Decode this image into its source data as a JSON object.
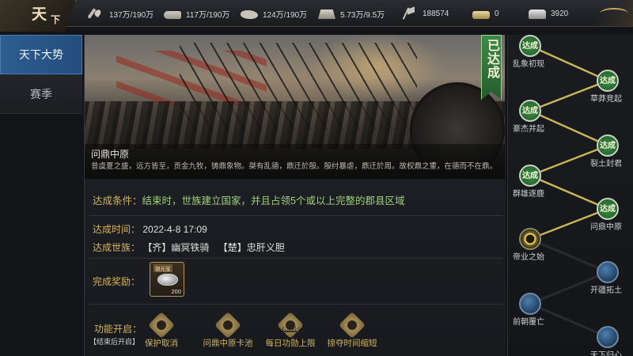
{
  "header": {
    "logo_char_1": "天",
    "logo_char_2": "下",
    "resources": [
      {
        "icon": "wheat-icon",
        "value": "137万/190万"
      },
      {
        "icon": "wood-icon",
        "value": "117万/190万"
      },
      {
        "icon": "stone-icon",
        "value": "124万/190万"
      },
      {
        "icon": "iron-icon",
        "value": "5.73万/9.5万"
      },
      {
        "icon": "flag-icon",
        "value": "188574"
      },
      {
        "icon": "gold-icon",
        "value": "0"
      },
      {
        "icon": "silver-icon",
        "value": "3920"
      }
    ]
  },
  "tabs": [
    {
      "label": "天下大势",
      "active": true
    },
    {
      "label": "赛季",
      "active": false
    }
  ],
  "event": {
    "badge": "已达成",
    "title": "问鼎中原",
    "description": "昔虞夏之盛，远方皆至，贡金九牧，铸鼎象物。桀有乱德，鼎迁於殷。殷纣暴虐，鼎迁於周。故权鼎之重，在德而不在鼎。",
    "condition_label": "达成条件：",
    "condition_text": "结束时，世族建立国家，并且占领5个或以上完整的郡县区域",
    "time_label": "达成时间：",
    "time_value": "2022-4-8 17:09",
    "clans_label": "达成世族：",
    "clans": [
      "【齐】幽冥铁骑",
      "【楚】忠肝义胆"
    ],
    "reward_label": "完成奖励：",
    "reward": {
      "tag": "银元宝",
      "count": "200"
    },
    "func_label": "功能开启：",
    "func_sublabel": "【结束后开启】",
    "functions": [
      {
        "name": "保护取消",
        "icon": "shield-cancel-icon",
        "num": ""
      },
      {
        "name": "问鼎中原卡池",
        "icon": "card-pool-icon",
        "num": ""
      },
      {
        "name": "每日功勋上限",
        "icon": "merit-limit-icon",
        "num": "80000"
      },
      {
        "name": "掠夺时间缩短",
        "icon": "raid-time-icon",
        "num": ""
      }
    ]
  },
  "timeline": {
    "nodes": [
      {
        "label": "乱象初现",
        "status": "done",
        "badge": "达成"
      },
      {
        "label": "草莽竞起",
        "status": "done",
        "badge": "达成"
      },
      {
        "label": "豪杰并起",
        "status": "done",
        "badge": "达成"
      },
      {
        "label": "裂土封君",
        "status": "done",
        "badge": "达成"
      },
      {
        "label": "群雄逐鹿",
        "status": "done",
        "badge": "达成"
      },
      {
        "label": "问鼎中原",
        "status": "done",
        "badge": "达成"
      },
      {
        "label": "帝业之始",
        "status": "current",
        "badge": ""
      },
      {
        "label": "开疆拓土",
        "status": "future",
        "badge": ""
      },
      {
        "label": "前朝覆亡",
        "status": "future",
        "badge": ""
      },
      {
        "label": "天下归心",
        "status": "future",
        "badge": ""
      }
    ]
  }
}
